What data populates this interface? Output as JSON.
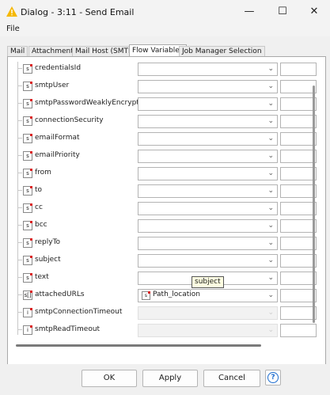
{
  "window": {
    "title": "Dialog - 3:11 - Send Email",
    "icon": "warning-triangle-icon",
    "controls": [
      "minimize-icon",
      "maximize-icon",
      "close-icon"
    ]
  },
  "menu": {
    "file": "File"
  },
  "tabs": [
    {
      "label": "Mail"
    },
    {
      "label": "Attachments"
    },
    {
      "label": "Mail Host (SMTP)"
    },
    {
      "label": "Flow Variables",
      "active": true
    },
    {
      "label": "Job Manager Selection"
    }
  ],
  "variables": [
    {
      "name": "credentialsId",
      "type": "s",
      "value": ""
    },
    {
      "name": "smtpUser",
      "type": "s",
      "value": ""
    },
    {
      "name": "smtpPasswordWeaklyEncrypted",
      "type": "s",
      "value": ""
    },
    {
      "name": "connectionSecurity",
      "type": "s",
      "value": ""
    },
    {
      "name": "emailFormat",
      "type": "s",
      "value": ""
    },
    {
      "name": "emailPriority",
      "type": "s",
      "value": ""
    },
    {
      "name": "from",
      "type": "s",
      "value": ""
    },
    {
      "name": "to",
      "type": "s",
      "value": ""
    },
    {
      "name": "cc",
      "type": "s",
      "value": ""
    },
    {
      "name": "bcc",
      "type": "s",
      "value": ""
    },
    {
      "name": "replyTo",
      "type": "s",
      "value": ""
    },
    {
      "name": "subject",
      "type": "s",
      "value": ""
    },
    {
      "name": "text",
      "type": "s",
      "value": ""
    },
    {
      "name": "attachedURLs",
      "type": "s[]",
      "value": "Path_location"
    },
    {
      "name": "smtpConnectionTimeout",
      "type": "i",
      "value": "",
      "disabled": true
    },
    {
      "name": "smtpReadTimeout",
      "type": "i",
      "value": "",
      "disabled": true
    }
  ],
  "tooltip": {
    "text": "subject"
  },
  "buttons": {
    "ok": "OK",
    "apply": "Apply",
    "cancel": "Cancel",
    "help_icon": "?"
  },
  "colors": {
    "accent": "#1f6fd1",
    "variable_marker": "#d92020",
    "warning": "#f5b800"
  }
}
